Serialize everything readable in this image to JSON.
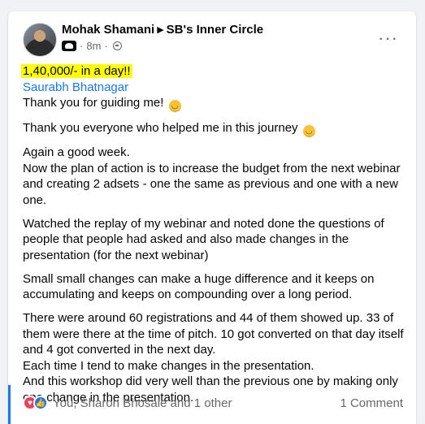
{
  "post": {
    "author": "Mohak Shamani",
    "group": "SB's Inner Circle",
    "time": "8m",
    "separator": "·",
    "more_label": "···",
    "icons": [
      "group-badge-icon",
      "globe-icon",
      "arrow-icon",
      "more-icon"
    ]
  },
  "content": {
    "headline": "1,40,000/- in a day!!",
    "mention": "Saurabh Bhatnagar",
    "line_thanks_guide": "Thank you for guiding me!",
    "line_thanks_everyone": "Thank you everyone who helped me in this journey",
    "paragraph_week_1": "Again a good week.",
    "paragraph_week_2": "Now the plan of action is to increase the budget from the next webinar and creating 2 adsets - one the same as previous and one with a new one.",
    "paragraph_replay": "Watched the replay of my webinar and noted done the questions of people that people had asked and also made changes in the presentation (for the next webinar)",
    "paragraph_small_changes": "Small small changes can make a huge difference and it keeps on accumulating and keeps on compounding over a long period.",
    "paragraph_stats": "There were around 60 registrations and 44 of them showed up. 33 of them were there at the time of pitch. 10 got converted on that day itself and 4 got converted in the next day.",
    "paragraph_each_time": "Each time I tend to make changes in the presentation.",
    "paragraph_workshop": "And this workshop did very well than the previous one by making only one change in the presentation."
  },
  "footer": {
    "reactors": "You, Sharon Bhosale and 1 other",
    "comments": "1 Comment"
  },
  "colors": {
    "highlight": "#ffff00",
    "link": "#1877f2",
    "love": "#f33e58",
    "like": "#1877f2"
  }
}
